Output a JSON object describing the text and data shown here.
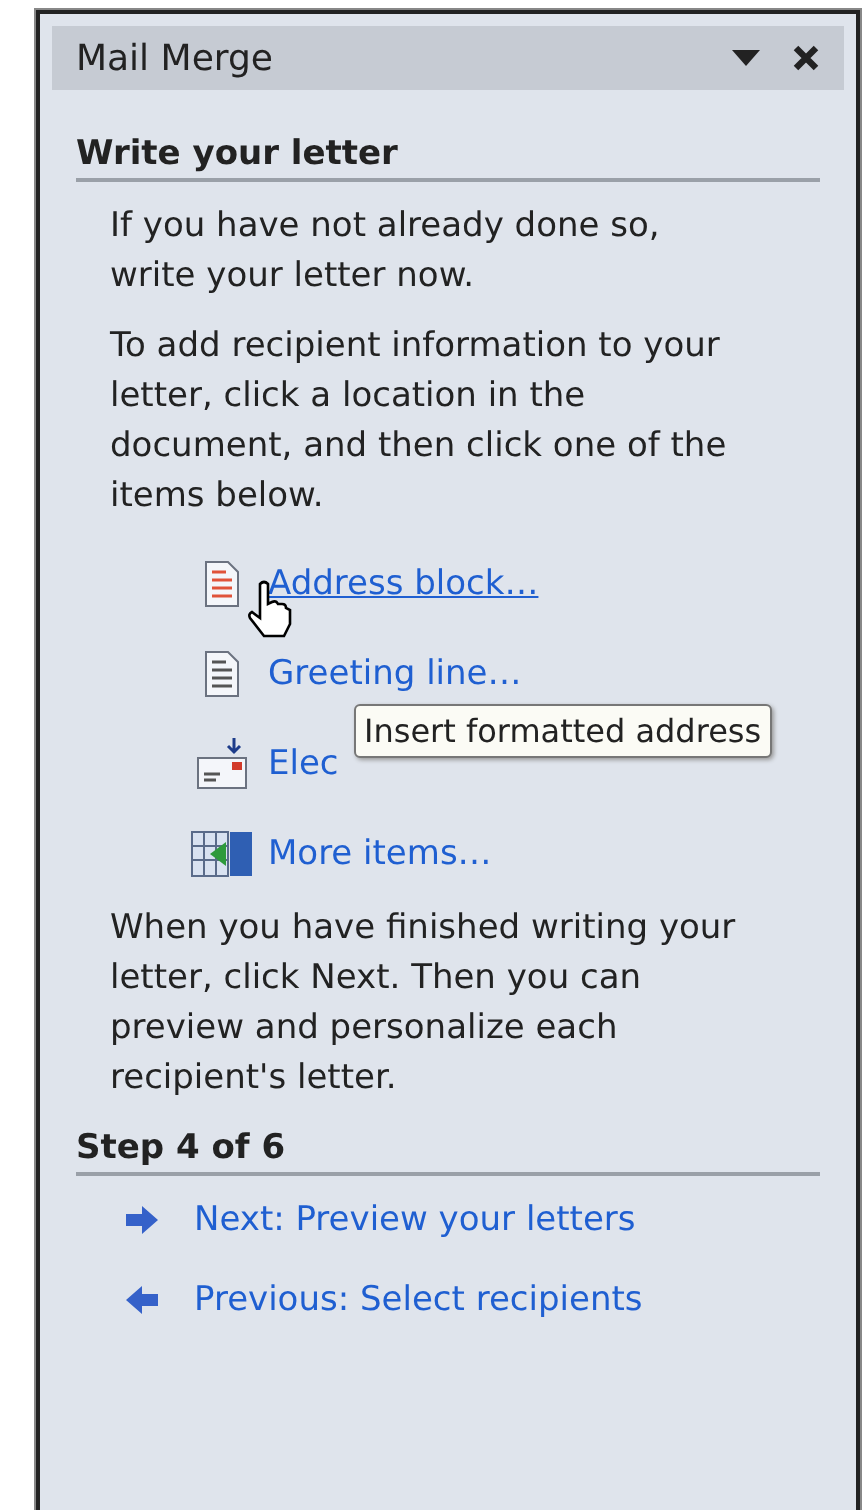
{
  "window": {
    "title": "Mail Merge"
  },
  "sections": [
    {
      "heading": "Write your letter",
      "paragraphs": [
        "If you have not already done so, write your letter now.",
        "To add recipient information to your letter, click a location in the document, and then click one of the items below."
      ],
      "items": [
        {
          "kind": "address",
          "label": "Address block…",
          "hovered": true
        },
        {
          "kind": "greeting",
          "label": "Greeting line…",
          "hovered": false
        },
        {
          "kind": "postage",
          "label": "Elec",
          "hovered": false
        },
        {
          "kind": "more",
          "label": "More items…",
          "hovered": false
        }
      ],
      "after": "When you have finished writing your letter, click Next. Then you can preview and personalize each recipient's letter."
    },
    {
      "heading": "Step 4 of 6",
      "nav": [
        {
          "kind": "next",
          "label": "Next: Preview your letters"
        },
        {
          "kind": "previous",
          "label": "Previous: Select recipients"
        }
      ]
    }
  ],
  "tooltip": "Insert formatted address"
}
